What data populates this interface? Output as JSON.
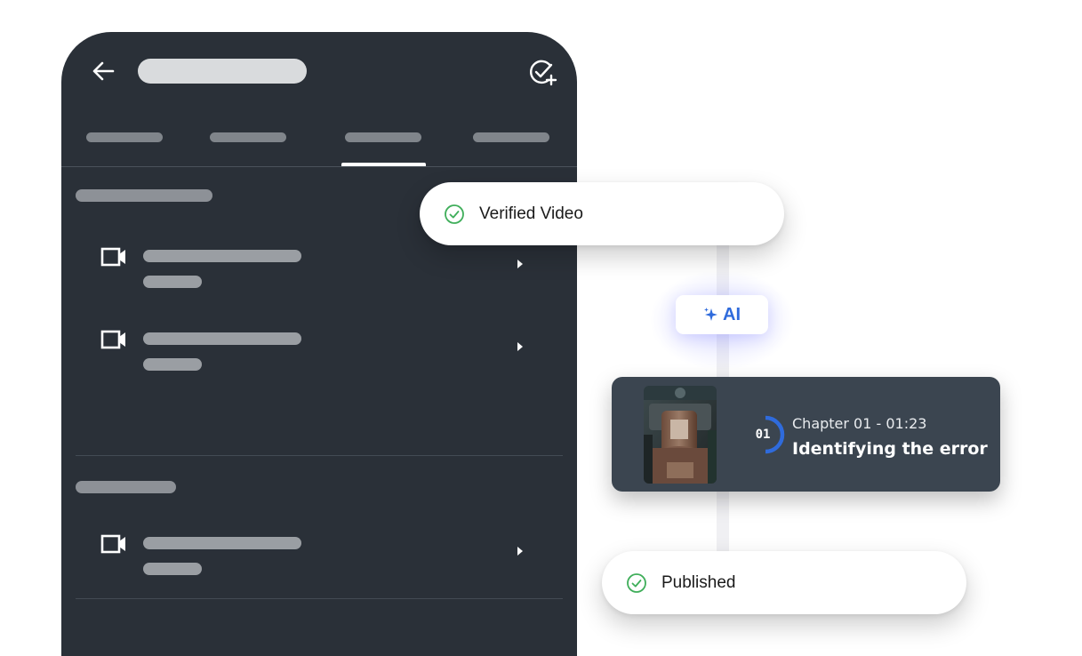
{
  "pipeline": {
    "verified_label": "Verified Video",
    "ai_badge_label": "AI",
    "published_label": "Published"
  },
  "chapter": {
    "number": "01",
    "meta": "Chapter 01 - 01:23",
    "title": "Identifying the error",
    "progress": 0.5
  },
  "colors": {
    "phone_bg": "#2a3038",
    "accent_blue": "#2f6bdc",
    "check_green": "#3fae5a",
    "card_bg": "#3b4550"
  },
  "icons": {
    "back": "arrow-left-icon",
    "header_action": "verify-add-icon",
    "list_item": "video-camera-icon",
    "chevron": "chevron-right-icon",
    "check": "check-circle-icon",
    "ai": "sparkle-icon"
  }
}
